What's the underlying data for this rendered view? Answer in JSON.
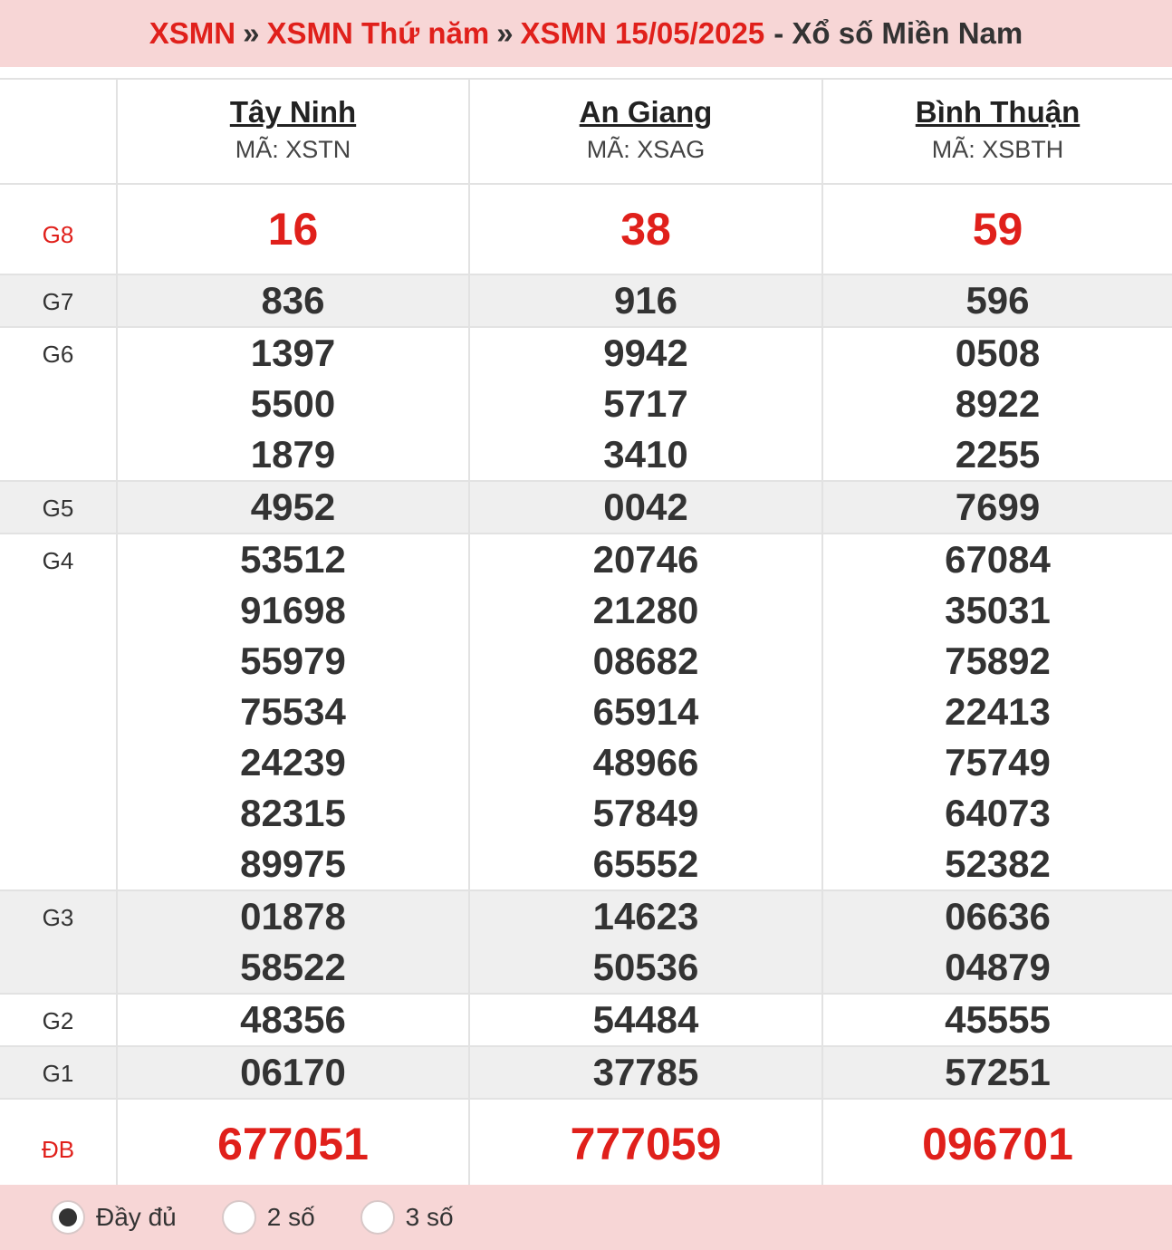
{
  "breadcrumb": {
    "link1": "XSMN",
    "link2": "XSMN Thứ năm",
    "link3": "XSMN 15/05/2025",
    "separator": "»",
    "suffix": "- Xổ số Miền Nam"
  },
  "provinces": [
    {
      "name": "Tây Ninh",
      "code": "MÃ: XSTN"
    },
    {
      "name": "An Giang",
      "code": "MÃ: XSAG"
    },
    {
      "name": "Bình Thuận",
      "code": "MÃ: XSBTH"
    }
  ],
  "prizes": [
    {
      "label": "G8",
      "values": [
        [
          "16"
        ],
        [
          "38"
        ],
        [
          "59"
        ]
      ]
    },
    {
      "label": "G7",
      "values": [
        [
          "836"
        ],
        [
          "916"
        ],
        [
          "596"
        ]
      ]
    },
    {
      "label": "G6",
      "values": [
        [
          "1397",
          "5500",
          "1879"
        ],
        [
          "9942",
          "5717",
          "3410"
        ],
        [
          "0508",
          "8922",
          "2255"
        ]
      ]
    },
    {
      "label": "G5",
      "values": [
        [
          "4952"
        ],
        [
          "0042"
        ],
        [
          "7699"
        ]
      ]
    },
    {
      "label": "G4",
      "values": [
        [
          "53512",
          "91698",
          "55979",
          "75534",
          "24239",
          "82315",
          "89975"
        ],
        [
          "20746",
          "21280",
          "08682",
          "65914",
          "48966",
          "57849",
          "65552"
        ],
        [
          "67084",
          "35031",
          "75892",
          "22413",
          "75749",
          "64073",
          "52382"
        ]
      ]
    },
    {
      "label": "G3",
      "values": [
        [
          "01878",
          "58522"
        ],
        [
          "14623",
          "50536"
        ],
        [
          "06636",
          "04879"
        ]
      ]
    },
    {
      "label": "G2",
      "values": [
        [
          "48356"
        ],
        [
          "54484"
        ],
        [
          "45555"
        ]
      ]
    },
    {
      "label": "G1",
      "values": [
        [
          "06170"
        ],
        [
          "37785"
        ],
        [
          "57251"
        ]
      ]
    },
    {
      "label": "ĐB",
      "values": [
        [
          "677051"
        ],
        [
          "777059"
        ],
        [
          "096701"
        ]
      ]
    }
  ],
  "colors": {
    "accent_red": "#e0201b",
    "header_bg": "#f7d6d6",
    "row_gray": "#efefef"
  },
  "footer": {
    "options": [
      {
        "label": "Đầy đủ",
        "selected": true
      },
      {
        "label": "2 số",
        "selected": false
      },
      {
        "label": "3 số",
        "selected": false
      }
    ]
  }
}
